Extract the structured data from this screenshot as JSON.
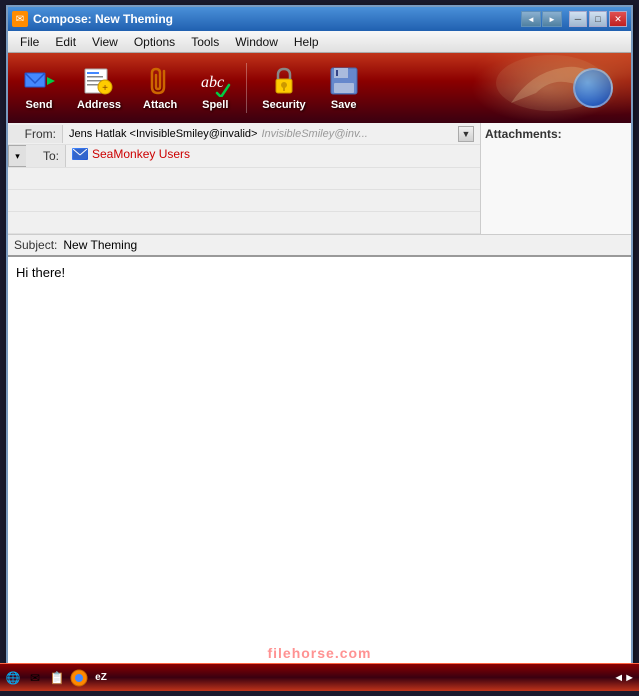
{
  "titlebar": {
    "title": "Compose: New Theming",
    "icon": "✉",
    "nav_back": "◄",
    "nav_fwd": "►",
    "btn_minimize": "─",
    "btn_maximize": "□",
    "btn_close": "✕"
  },
  "menubar": {
    "items": [
      "File",
      "Edit",
      "View",
      "Options",
      "Tools",
      "Window",
      "Help"
    ]
  },
  "toolbar": {
    "buttons": [
      {
        "id": "send",
        "label": "Send",
        "icon": "📤"
      },
      {
        "id": "address",
        "label": "Address",
        "icon": "📋"
      },
      {
        "id": "attach",
        "label": "Attach",
        "icon": "📎"
      },
      {
        "id": "spell",
        "label": "Spell",
        "icon": "✔"
      },
      {
        "id": "security",
        "label": "Security",
        "icon": "🔒"
      },
      {
        "id": "save",
        "label": "Save",
        "icon": "💾"
      }
    ]
  },
  "header": {
    "from_label": "From:",
    "from_main": "Jens Hatlak <InvisibleSmiley@invalid>",
    "from_italic": "InvisibleSmiley@inv...",
    "to_label": "To:",
    "to_expand": "▾",
    "recipient_icon": "👥",
    "recipient_name": "SeaMonkey Users",
    "attachments_label": "Attachments:"
  },
  "subject": {
    "label": "Subject:",
    "value": "New Theming"
  },
  "body": {
    "text": "Hi there!"
  },
  "taskbar": {
    "icons": [
      "🌐",
      "✉",
      "📋",
      "🦊",
      "eZ"
    ],
    "right": "◄►"
  },
  "watermark": {
    "prefix": "filehorse",
    "suffix": ".com"
  }
}
